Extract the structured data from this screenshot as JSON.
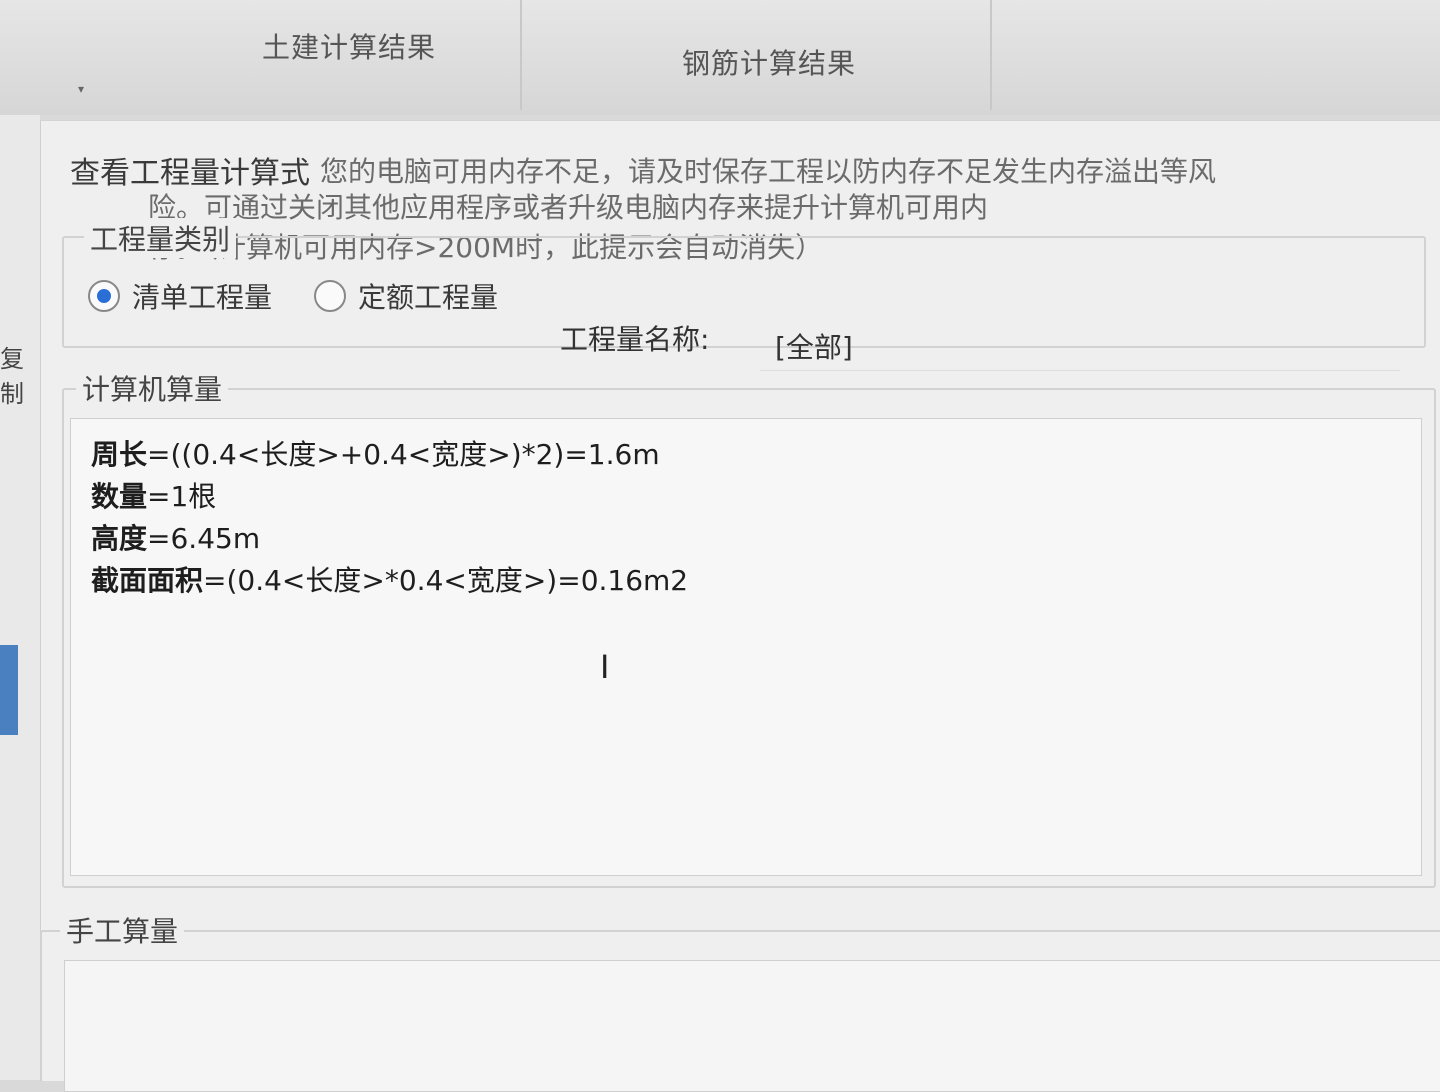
{
  "tabs": {
    "civil": "土建计算结果",
    "rebar": "钢筋计算结果"
  },
  "left_edge_text": "复制",
  "dialog": {
    "title": "查看工程量计算式",
    "warning": {
      "line1": "您的电脑可用内存不足，请及时保存工程以防内存不足发生内存溢出等风",
      "line2": "险。可通过关闭其他应用程序或者升级电脑内存来提升计算机可用内",
      "line3": "存。（计算机可用内存>200M时，此提示会自动消失）"
    },
    "quantity_type": {
      "title": "工程量类别",
      "options": [
        "清单工程量",
        "定额工程量"
      ],
      "selected": "清单工程量"
    },
    "quantity_name": {
      "label": "工程量名称:",
      "value": "[全部]"
    },
    "computer_calc": {
      "title": "计算机算量",
      "lines": [
        {
          "label": "周长",
          "expr": "=((0.4<长度>+0.4<宽度>)*2)=1.6m"
        },
        {
          "label": "数量",
          "expr": "=1根"
        },
        {
          "label": "高度",
          "expr": "=6.45m"
        },
        {
          "label": "截面面积",
          "expr": "=(0.4<长度>*0.4<宽度>)=0.16m2"
        }
      ]
    },
    "manual_calc": {
      "title": "手工算量"
    }
  },
  "colors": {
    "radio_selected": "#2a6fd6",
    "left_bar": "#4a7fc0"
  }
}
